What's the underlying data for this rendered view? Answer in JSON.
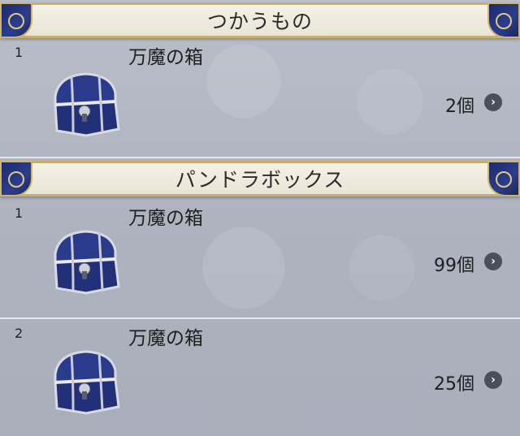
{
  "sections": [
    {
      "title": "つかうもの",
      "items": [
        {
          "num": "1",
          "name": "万魔の箱",
          "count": "2個"
        }
      ]
    },
    {
      "title": "パンドラボックス",
      "items": [
        {
          "num": "1",
          "name": "万魔の箱",
          "count": "99個"
        },
        {
          "num": "2",
          "name": "万魔の箱",
          "count": "25個"
        }
      ]
    }
  ],
  "icons": {
    "item": "treasure-chest-icon",
    "more": "chevron-right-icon"
  },
  "colors": {
    "header_bg": "#f4f1e6",
    "header_border": "#c8b06a",
    "corner_blue": "#1c2a6b",
    "chest_blue": "#2a3a8c"
  }
}
